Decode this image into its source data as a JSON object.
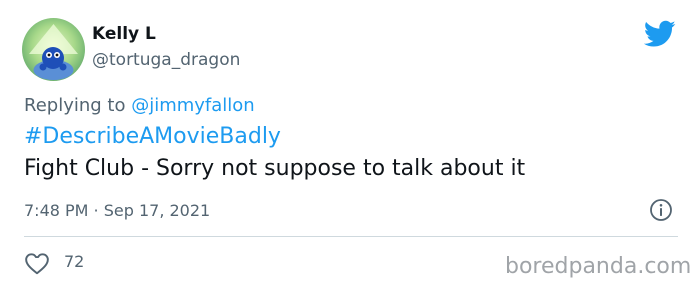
{
  "tweet": {
    "author_name": "Kelly L",
    "author_handle": "@tortuga_dragon",
    "reply_prefix": "Replying to ",
    "reply_to": "@jimmyfallon",
    "hashtag": "#DescribeAMovieBadly",
    "text": "Fight Club - Sorry not suppose to talk about it",
    "timestamp": "7:48 PM · Sep 17, 2021",
    "like_count": "72"
  },
  "icons": {
    "brand": "twitter-bird-icon",
    "info": "info-icon",
    "like": "heart-icon"
  },
  "watermark": "boredpanda.com",
  "colors": {
    "accent": "#1d9bf0",
    "secondary_text": "#536471",
    "divider": "#cfd9de",
    "watermark": "#a0a4a8"
  }
}
